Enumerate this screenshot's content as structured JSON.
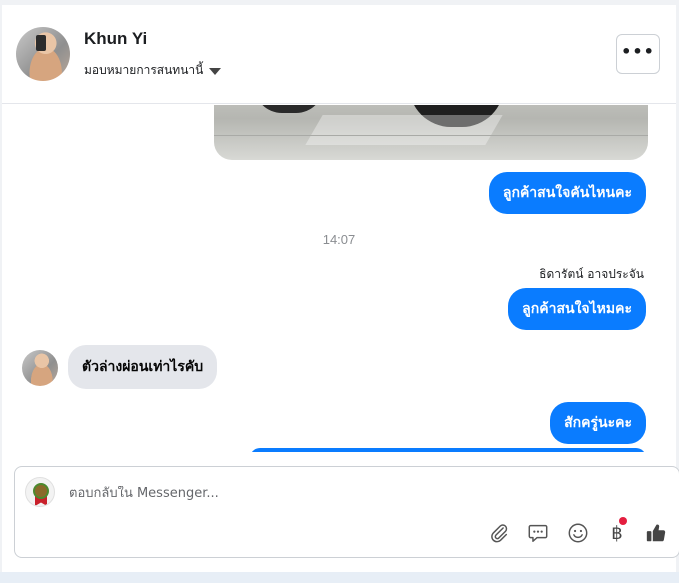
{
  "header": {
    "contact_name": "Khun Yi",
    "assign_label": "มอบหมายการสนทนานี้",
    "more_label": "•••"
  },
  "messages": {
    "outgoing_1": "ลูกค้าสนใจคันไหนคะ",
    "timestamp": "14:07",
    "sender_name": "ธิดารัตน์ อาจประจัน",
    "outgoing_2": "ลูกค้าสนใจไหมคะ",
    "incoming_1": "ตัวล่างผ่อนเท่าไรคับ",
    "outgoing_3": "สักครู่นะคะ"
  },
  "composer": {
    "placeholder": "ตอบกลับใน Messenger...",
    "value": "",
    "icons": [
      "paperclip-icon",
      "saved-reply-icon",
      "emoji-icon",
      "baht-payment-icon",
      "thumbs-up-icon"
    ]
  },
  "colors": {
    "accent": "#0a7cff",
    "incoming_bubble": "#e4e6eb",
    "notification_dot": "#e41e3f",
    "muted_text": "#8a8d91"
  }
}
